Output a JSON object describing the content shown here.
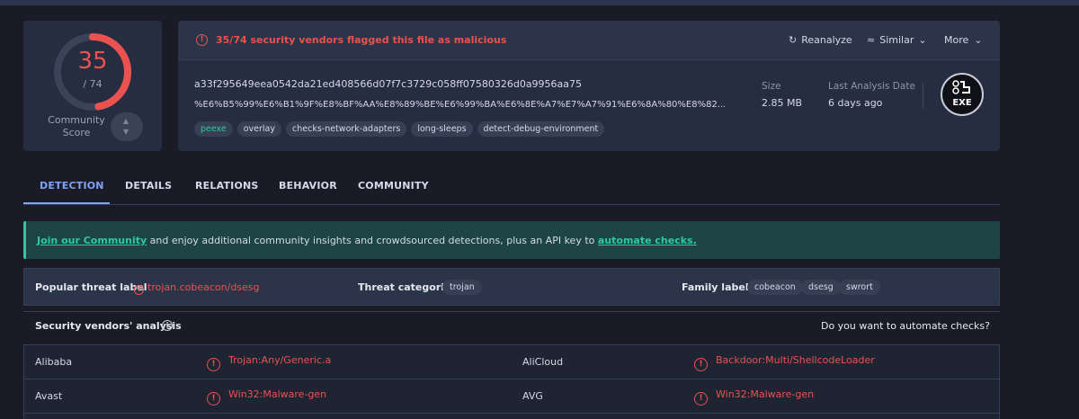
{
  "score": {
    "detected": "35",
    "total": "/ 74",
    "community_label": "Community Score",
    "fraction": 0.473
  },
  "alert": {
    "icon": "alert-circle-icon",
    "text": "35/74 security vendors flagged this file as malicious"
  },
  "actions": {
    "reanalyze": "Reanalyze",
    "similar": "Similar",
    "more": "More"
  },
  "file": {
    "hash": "a33f295649eea0542da21ed408566d07f7c3729c058ff07580326d0a9956aa75",
    "name": "%E6%B5%99%E6%B1%9F%E8%BF%AA%E8%89%BE%E6%99%BA%E6%8E%A7%E7%A7%91%E6%8A%80%E8%82...",
    "tags": [
      "peexe",
      "overlay",
      "checks-network-adapters",
      "long-sleeps",
      "detect-debug-environment"
    ],
    "size_label": "Size",
    "size_value": "2.85 MB",
    "date_label": "Last Analysis Date",
    "date_value": "6 days ago",
    "type_icon_text": "EXE"
  },
  "tabs": [
    "DETECTION",
    "DETAILS",
    "RELATIONS",
    "BEHAVIOR",
    "COMMUNITY"
  ],
  "banner": {
    "link1": "Join our Community",
    "text": " and enjoy additional community insights and crowdsourced detections, plus an API key to ",
    "link2": "automate checks."
  },
  "threat": {
    "popular_label": "Popular threat label",
    "popular_value": "trojan.cobeacon/dsesg",
    "categories_label": "Threat categories",
    "categories": [
      "trojan"
    ],
    "family_label": "Family labels",
    "families": [
      "cobeacon",
      "dsesg",
      "swrort"
    ]
  },
  "vendors": {
    "title": "Security vendors' analysis",
    "automate_question": "Do you want to automate checks?",
    "rows": [
      {
        "left_name": "Alibaba",
        "left_result": "Trojan:Any/Generic.a",
        "right_name": "AliCloud",
        "right_result": "Backdoor:Multi/ShellcodeLoader"
      },
      {
        "left_name": "Avast",
        "left_result": "Win32:Malware-gen",
        "right_name": "AVG",
        "right_result": "Win32:Malware-gen"
      }
    ]
  },
  "colors": {
    "malicious": "#e9524f",
    "accent": "#7fa3f5",
    "community": "#2ec9a0"
  }
}
